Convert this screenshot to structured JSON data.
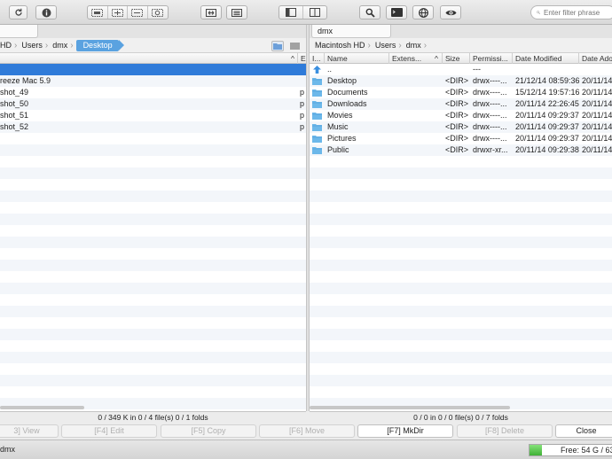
{
  "toolbar": {
    "search_placeholder": "Enter filter phrase",
    "icons": [
      "refresh-icon",
      "info-icon",
      "view-mode-icon",
      "compare-icon",
      "edit-panel-icon",
      "single-panel-icon",
      "dual-panel-icon",
      "search-icon",
      "terminal-icon",
      "network-icon",
      "preview-icon"
    ]
  },
  "left": {
    "tab": "",
    "path": [
      "HD",
      "Users",
      "dmx",
      "Desktop"
    ],
    "columns": {
      "ext": "E"
    },
    "rows": [
      {
        "name": "",
        "ext": "",
        "selected": true
      },
      {
        "name": "reeze Mac 5.9",
        "ext": ""
      },
      {
        "name": "shot_49",
        "ext": "p"
      },
      {
        "name": "shot_50",
        "ext": "p"
      },
      {
        "name": "shot_51",
        "ext": "p"
      },
      {
        "name": "shot_52",
        "ext": "p"
      }
    ],
    "status": "0 / 349 K in 0 / 4 file(s) 0 / 1 folds"
  },
  "right": {
    "tab": "dmx",
    "path": [
      "Macintosh HD",
      "Users",
      "dmx"
    ],
    "columns": {
      "icon": "I...",
      "name": "Name",
      "ext": "Extens...",
      "size": "Size",
      "perm": "Permissi...",
      "modified": "Date Modified",
      "added": "Date Ado"
    },
    "rows": [
      {
        "icon": "up",
        "name": "..",
        "ext": "",
        "size": "",
        "perm": "---",
        "modified": "",
        "added": ""
      },
      {
        "icon": "folder",
        "name": "Desktop",
        "ext": "",
        "size": "<DIR>",
        "perm": "drwx----...",
        "modified": "21/12/14 08:59:36",
        "added": "20/11/14"
      },
      {
        "icon": "folder",
        "name": "Documents",
        "ext": "",
        "size": "<DIR>",
        "perm": "drwx----...",
        "modified": "15/12/14 19:57:16",
        "added": "20/11/14"
      },
      {
        "icon": "folder",
        "name": "Downloads",
        "ext": "",
        "size": "<DIR>",
        "perm": "drwx----...",
        "modified": "20/11/14 22:26:45",
        "added": "20/11/14"
      },
      {
        "icon": "folder",
        "name": "Movies",
        "ext": "",
        "size": "<DIR>",
        "perm": "drwx----...",
        "modified": "20/11/14 09:29:37",
        "added": "20/11/14"
      },
      {
        "icon": "folder",
        "name": "Music",
        "ext": "",
        "size": "<DIR>",
        "perm": "drwx----...",
        "modified": "20/11/14 09:29:37",
        "added": "20/11/14"
      },
      {
        "icon": "folder",
        "name": "Pictures",
        "ext": "",
        "size": "<DIR>",
        "perm": "drwx----...",
        "modified": "20/11/14 09:29:37",
        "added": "20/11/14"
      },
      {
        "icon": "folder",
        "name": "Public",
        "ext": "",
        "size": "<DIR>",
        "perm": "drwxr-xr...",
        "modified": "20/11/14 09:29:38",
        "added": "20/11/14"
      }
    ],
    "status": "0 / 0 in 0 / 0 file(s) 0 / 7 folds"
  },
  "fkeys": [
    {
      "label": "3] View",
      "enabled": false
    },
    {
      "label": "[F4] Edit",
      "enabled": false
    },
    {
      "label": "[F5] Copy",
      "enabled": false
    },
    {
      "label": "[F6] Move",
      "enabled": false
    },
    {
      "label": "[F7] MkDir",
      "enabled": true
    },
    {
      "label": "[F8] Delete",
      "enabled": false
    },
    {
      "label": "Close",
      "enabled": true
    }
  ],
  "bottom": {
    "command_prompt": "dmx",
    "free_space": "Free: 54 G / 63",
    "free_fraction": 0.14
  },
  "colors": {
    "selection": "#2f7bd9",
    "breadcrumb_active": "#5aa2e0",
    "folder": "#6cb8ea"
  }
}
